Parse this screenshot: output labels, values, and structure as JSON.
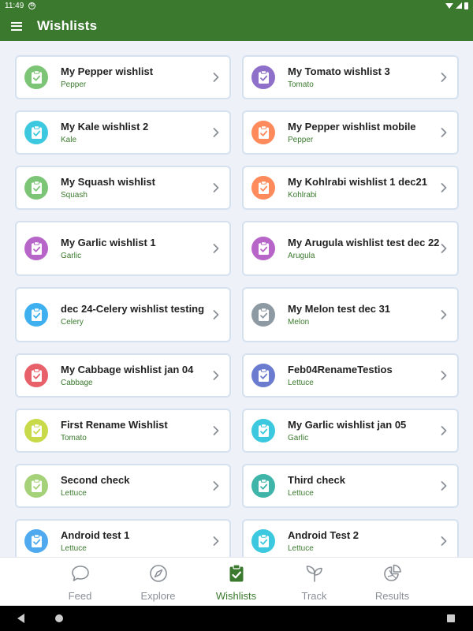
{
  "status": {
    "time": "11:49",
    "indicator": "G"
  },
  "app_bar": {
    "title": "Wishlists"
  },
  "wishlists": [
    {
      "title": "My Pepper wishlist",
      "crop": "Pepper",
      "color": "#7cc576"
    },
    {
      "title": "My Tomato wishlist 3",
      "crop": "Tomato",
      "color": "#8e6fc9"
    },
    {
      "title": "My Kale wishlist 2",
      "crop": "Kale",
      "color": "#3cc9e0"
    },
    {
      "title": "My Pepper wishlist mobile",
      "crop": "Pepper",
      "color": "#ff8a5b"
    },
    {
      "title": "My Squash wishlist",
      "crop": "Squash",
      "color": "#7cc576"
    },
    {
      "title": "My Kohlrabi wishlist 1 dec21",
      "crop": "Kohlrabi",
      "color": "#ff8a5b"
    },
    {
      "title": "My Garlic wishlist 1",
      "crop": "Garlic",
      "color": "#b765c8"
    },
    {
      "title": "My Arugula wishlist test dec 22",
      "crop": "Arugula",
      "color": "#b765c8"
    },
    {
      "title": "dec 24-Celery wishlist testing",
      "crop": "Celery",
      "color": "#3eb0ef"
    },
    {
      "title": "My Melon test dec 31",
      "crop": "Melon",
      "color": "#8d9aa3"
    },
    {
      "title": "My Cabbage wishlist jan 04",
      "crop": "Cabbage",
      "color": "#e8606a"
    },
    {
      "title": "Feb04RenameTestios",
      "crop": "Lettuce",
      "color": "#6b7bd0"
    },
    {
      "title": "First Rename Wishlist",
      "crop": "Tomato",
      "color": "#c8d94a"
    },
    {
      "title": "My Garlic wishlist jan 05",
      "crop": "Garlic",
      "color": "#3cc9e0"
    },
    {
      "title": "Second check",
      "crop": "Lettuce",
      "color": "#a5d178"
    },
    {
      "title": "Third check",
      "crop": "Lettuce",
      "color": "#3eb5a8"
    },
    {
      "title": "Android test 1",
      "crop": "Lettuce",
      "color": "#4ea9ef"
    },
    {
      "title": "Android Test 2",
      "crop": "Lettuce",
      "color": "#3cc9e0"
    }
  ],
  "bottom_nav": [
    {
      "label": "Feed",
      "icon": "chat-bubble-icon",
      "active": false
    },
    {
      "label": "Explore",
      "icon": "compass-icon",
      "active": false
    },
    {
      "label": "Wishlists",
      "icon": "clipboard-check-icon",
      "active": true
    },
    {
      "label": "Track",
      "icon": "sprout-icon",
      "active": false
    },
    {
      "label": "Results",
      "icon": "pie-chart-icon",
      "active": false
    }
  ],
  "colors": {
    "primary": "#3b7a2e",
    "background": "#eef1f7",
    "card_border": "#d6e1f0",
    "inactive_nav": "#8a8f96"
  }
}
